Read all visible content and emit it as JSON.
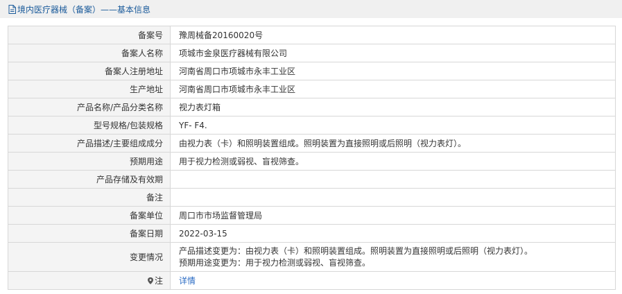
{
  "header": {
    "title": "境内医疗器械（备案）——基本信息",
    "icon": "document-icon"
  },
  "rows": [
    {
      "label": "备案号",
      "value": "豫周械备20160020号"
    },
    {
      "label": "备案人名称",
      "value": "项城市金泉医疗器械有限公司"
    },
    {
      "label": "备案人注册地址",
      "value": "河南省周口市项城市永丰工业区"
    },
    {
      "label": "生产地址",
      "value": "河南省周口市项城市永丰工业区"
    },
    {
      "label": "产品名称/产品分类名称",
      "value": "视力表灯箱"
    },
    {
      "label": "型号规格/包装规格",
      "value": "YF- F4."
    },
    {
      "label": "产品描述/主要组成成分",
      "value": "由视力表（卡）和照明装置组成。照明装置为直接照明或后照明（视力表灯）。"
    },
    {
      "label": "预期用途",
      "value": "用于视力检测或弱视、盲视筛查。"
    },
    {
      "label": "产品存储及有效期",
      "value": ""
    },
    {
      "label": "备注",
      "value": ""
    },
    {
      "label": "备案单位",
      "value": "周口市市场监督管理局"
    },
    {
      "label": "备案日期",
      "value": "2022-03-15"
    }
  ],
  "changes": {
    "label": "变更情况",
    "line1": "产品描述变更为：由视力表（卡）和照明装置组成。照明装置为直接照明或后照明（视力表灯）。",
    "line2": "预期用途变更为：用于视力检测或弱视、盲视筛查。"
  },
  "note": {
    "label": "注",
    "link": "详情",
    "icon": "pin-icon"
  }
}
